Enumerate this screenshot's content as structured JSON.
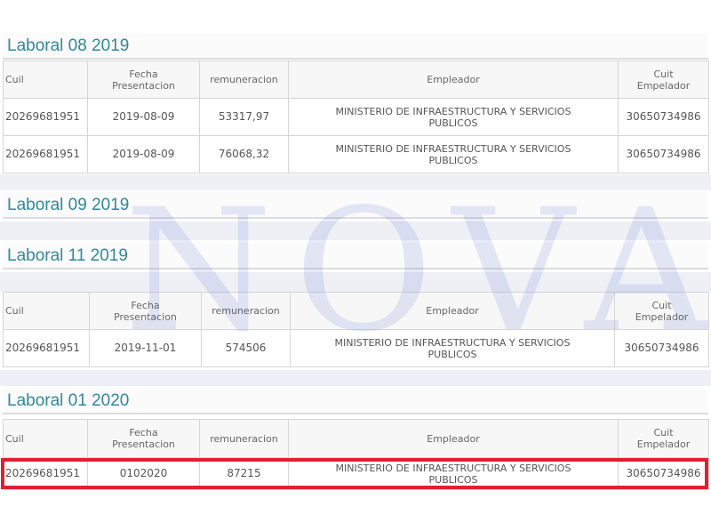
{
  "headers": {
    "cuil": "Cuil",
    "fecha_line1": "Fecha",
    "fecha_line2": "Presentacion",
    "remuneracion": "remuneracion",
    "empleador": "Empleador",
    "cuit_line1": "Cuit",
    "cuit_line2": "Empelador"
  },
  "sections": [
    {
      "title": "Laboral 08 2019",
      "rows": [
        {
          "cuil": "20269681951",
          "fecha": "2019-08-09",
          "remuneracion": "53317,97",
          "empleador_1": "MINISTERIO DE INFRAESTRUCTURA Y SERVICIOS",
          "empleador_2": "PUBLICOS",
          "cuit": "30650734986"
        },
        {
          "cuil": "20269681951",
          "fecha": "2019-08-09",
          "remuneracion": "76068,32",
          "empleador_1": "MINISTERIO DE INFRAESTRUCTURA Y SERVICIOS",
          "empleador_2": "PUBLICOS",
          "cuit": "30650734986"
        }
      ]
    },
    {
      "title": "Laboral 09 2019",
      "rows": []
    },
    {
      "title": "Laboral 11 2019",
      "rows": [
        {
          "cuil": "20269681951",
          "fecha": "2019-11-01",
          "remuneracion": "574506",
          "empleador_1": "MINISTERIO DE INFRAESTRUCTURA Y SERVICIOS",
          "empleador_2": "PUBLICOS",
          "cuit": "30650734986"
        }
      ]
    },
    {
      "title": "Laboral 01 2020",
      "rows": [
        {
          "cuil": "20269681951",
          "fecha": "0102020",
          "remuneracion": "87215",
          "empleador_1": "MINISTERIO DE INFRAESTRUCTURA Y SERVICIOS",
          "empleador_2": "PUBLICOS",
          "cuit": "30650734986"
        }
      ]
    }
  ],
  "watermark": "NOVA",
  "highlight_color": "#e02030",
  "title_color": "#30889a"
}
